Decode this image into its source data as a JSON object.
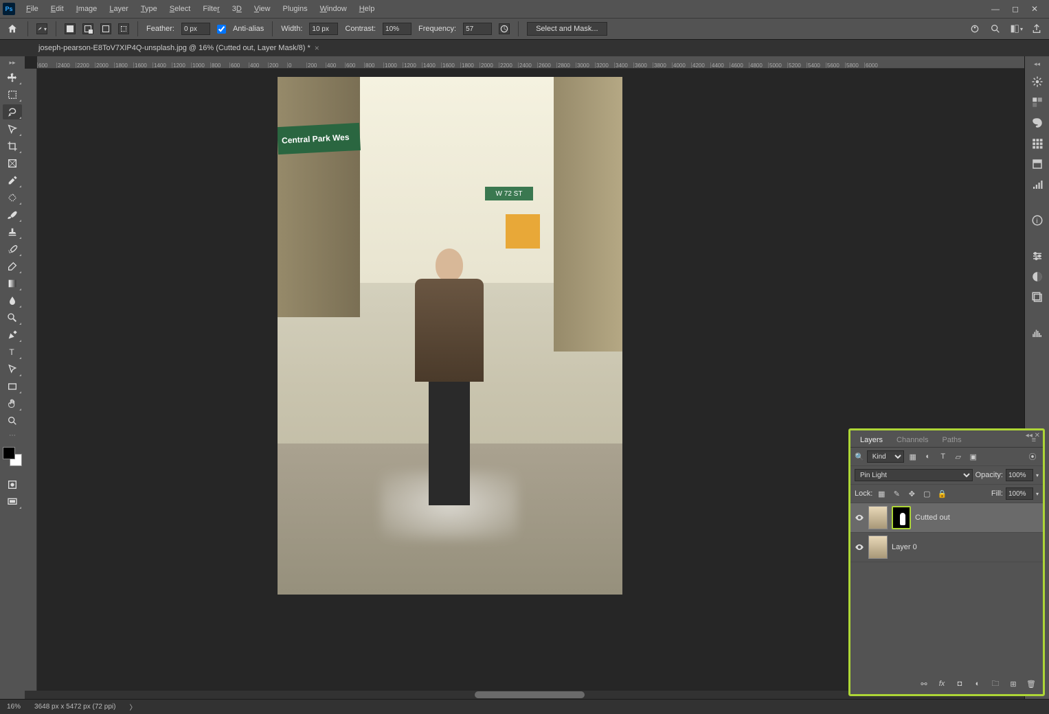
{
  "app": {
    "name": "Ps"
  },
  "menu": [
    "File",
    "Edit",
    "Image",
    "Layer",
    "Type",
    "Select",
    "Filter",
    "3D",
    "View",
    "Plugins",
    "Window",
    "Help"
  ],
  "options": {
    "feather_label": "Feather:",
    "feather_value": "0 px",
    "antialias_label": "Anti-alias",
    "width_label": "Width:",
    "width_value": "10 px",
    "contrast_label": "Contrast:",
    "contrast_value": "10%",
    "frequency_label": "Frequency:",
    "frequency_value": "57",
    "select_mask": "Select and Mask..."
  },
  "doc_tab": "joseph-pearson-E8ToV7XIP4Q-unsplash.jpg @ 16% (Cutted out, Layer Mask/8) *",
  "ruler_marks": [
    "600",
    "2400",
    "2200",
    "2000",
    "1800",
    "1600",
    "1400",
    "1200",
    "1000",
    "800",
    "600",
    "400",
    "200",
    "0",
    "200",
    "400",
    "600",
    "800",
    "1000",
    "1200",
    "1400",
    "1600",
    "1800",
    "2000",
    "2200",
    "2400",
    "2600",
    "2800",
    "3000",
    "3200",
    "3400",
    "3600",
    "3800",
    "4000",
    "4200",
    "4400",
    "4600",
    "4800",
    "5000",
    "5200",
    "5400",
    "5600",
    "5800",
    "6000"
  ],
  "image": {
    "sign1": "Central Park Wes",
    "sign2": "W 72 ST"
  },
  "layers_panel": {
    "tabs": [
      "Layers",
      "Channels",
      "Paths"
    ],
    "filter_label": "Kind",
    "blend_mode": "Pin Light",
    "opacity_label": "Opacity:",
    "opacity_value": "100%",
    "lock_label": "Lock:",
    "fill_label": "Fill:",
    "fill_value": "100%",
    "layers": [
      {
        "name": "Cutted out",
        "selected": true,
        "has_mask": true
      },
      {
        "name": "Layer 0",
        "selected": false,
        "has_mask": false
      }
    ]
  },
  "status": {
    "zoom": "16%",
    "doc_info": "3648 px x 5472 px (72 ppi)"
  }
}
